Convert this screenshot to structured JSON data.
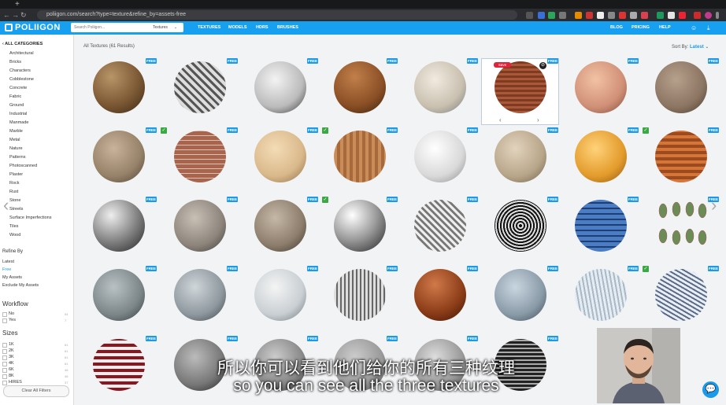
{
  "browser": {
    "new_tab_label": "+",
    "url": "poliigon.com/search?type=texture&refine_by=assets-free",
    "nav_icons": {
      "back": "arrow-left-icon",
      "forward": "arrow-right-icon",
      "reload": "reload-icon"
    }
  },
  "header": {
    "logo": "POLIIGON",
    "search_placeholder": "Search Poliigon...",
    "search_type": "Textures",
    "nav": [
      "TEXTURES",
      "MODELS",
      "HDRS",
      "BRUSHES"
    ],
    "right_nav": [
      "BLOG",
      "PRICING",
      "HELP"
    ]
  },
  "sidebar": {
    "all_categories": "ALL CATEGORIES",
    "categories": [
      "Architectural",
      "Bricks",
      "Characters",
      "Cobblestone",
      "Concrete",
      "Fabric",
      "Ground",
      "Industrial",
      "Manmade",
      "Marble",
      "Metal",
      "Nature",
      "Patterns",
      "Photoscanned",
      "Plaster",
      "Rock",
      "Rust",
      "Stone",
      "Streets",
      "Surface Imperfections",
      "Tiles",
      "Wood"
    ],
    "refine_title": "Refine By",
    "refine_items": [
      "Latest",
      "Free",
      "My Assets",
      "Exclude My Assets"
    ],
    "workflow_title": "Workflow",
    "workflow_options": [
      {
        "label": "No",
        "count": "54"
      },
      {
        "label": "Yes",
        "count": "7"
      }
    ],
    "sizes_title": "Sizes",
    "sizes": [
      {
        "label": "1K",
        "count": "61"
      },
      {
        "label": "2K",
        "count": "61"
      },
      {
        "label": "3K",
        "count": "61"
      },
      {
        "label": "4K",
        "count": "61"
      },
      {
        "label": "6K",
        "count": "46"
      },
      {
        "label": "8K",
        "count": "46"
      },
      {
        "label": "HIRES",
        "count": "37"
      }
    ],
    "clear_button": "Clear All Filters"
  },
  "main": {
    "results_text": "All Textures (61 Results)",
    "sort_label": "Sort By:",
    "sort_value": "Latest",
    "free_badge": "FREE",
    "save_button": "Save",
    "check_mark": "✓",
    "prev_arrow": "‹",
    "next_arrow": "›",
    "big_prev": "‹",
    "big_next": "›"
  },
  "subtitles": {
    "zh": "所以你可以看到他们给你的所有三种纹理",
    "en": "so you can see all the three textures"
  },
  "chat_icon": "chat-bubble-icon"
}
